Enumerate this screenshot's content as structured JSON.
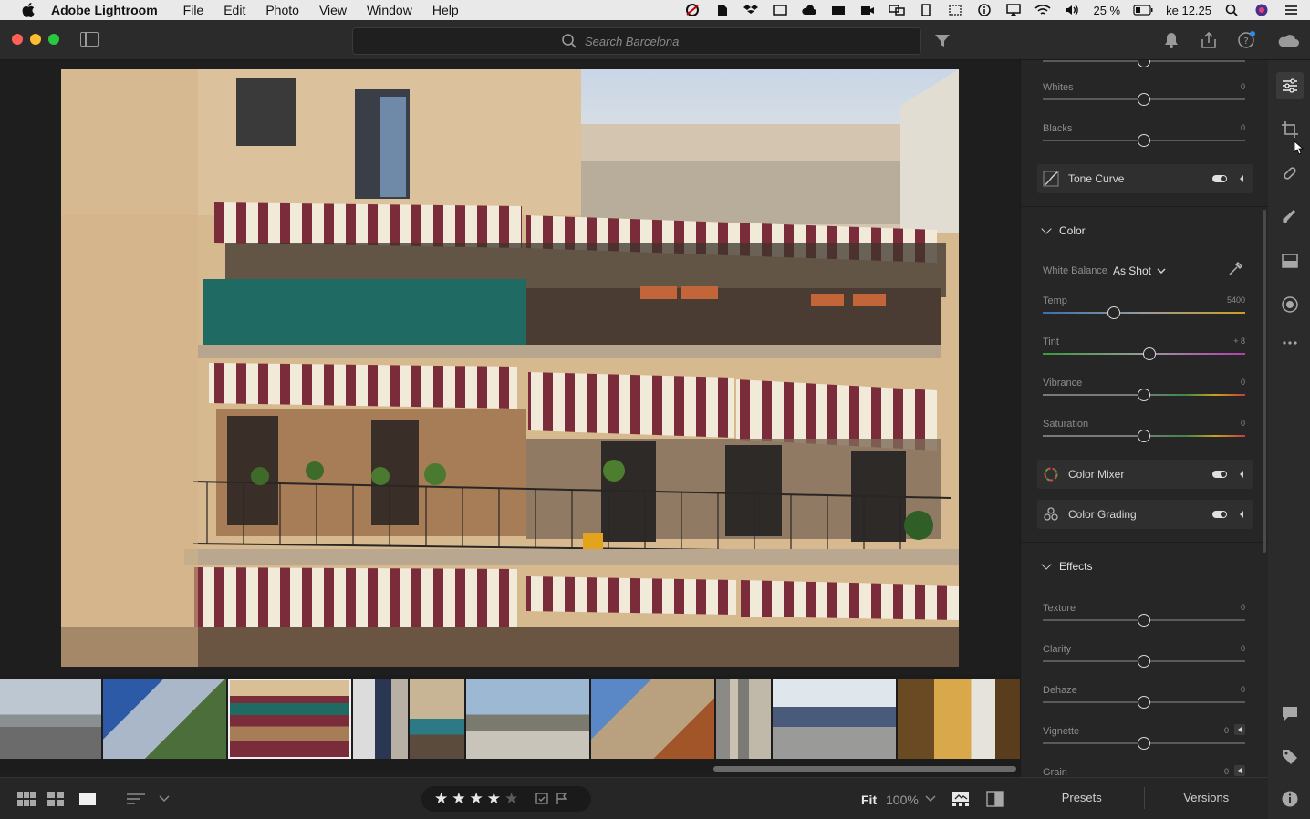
{
  "menubar": {
    "app_name": "Adobe Lightroom",
    "menus": [
      "File",
      "Edit",
      "Photo",
      "View",
      "Window",
      "Help"
    ],
    "battery": "25 %",
    "clock": "ke 12.25"
  },
  "search": {
    "placeholder": "Search Barcelona"
  },
  "edit": {
    "light_sliders": [
      {
        "label": "Whites",
        "value": "0"
      },
      {
        "label": "Blacks",
        "value": "0"
      }
    ],
    "tone_curve": "Tone Curve",
    "color": {
      "header": "Color",
      "white_balance_label": "White Balance",
      "white_balance_value": "As Shot",
      "sliders": [
        {
          "label": "Temp",
          "value": "5400"
        },
        {
          "label": "Tint",
          "value": "+ 8"
        },
        {
          "label": "Vibrance",
          "value": "0"
        },
        {
          "label": "Saturation",
          "value": "0"
        }
      ]
    },
    "color_mixer": "Color Mixer",
    "color_grading": "Color Grading",
    "effects": {
      "header": "Effects",
      "sliders": [
        {
          "label": "Texture",
          "value": "0"
        },
        {
          "label": "Clarity",
          "value": "0"
        },
        {
          "label": "Dehaze",
          "value": "0"
        },
        {
          "label": "Vignette",
          "value": "0"
        },
        {
          "label": "Grain",
          "value": "0"
        }
      ]
    }
  },
  "bottombar": {
    "rating": 4,
    "rating_max": 5,
    "fit_label": "Fit",
    "zoom_label": "100%"
  },
  "panel_tabs": {
    "presets": "Presets",
    "versions": "Versions"
  },
  "colors": {
    "accent_selected": "#f0f0f0",
    "panel_bg": "#262626",
    "app_bg": "#1e1e1e"
  }
}
